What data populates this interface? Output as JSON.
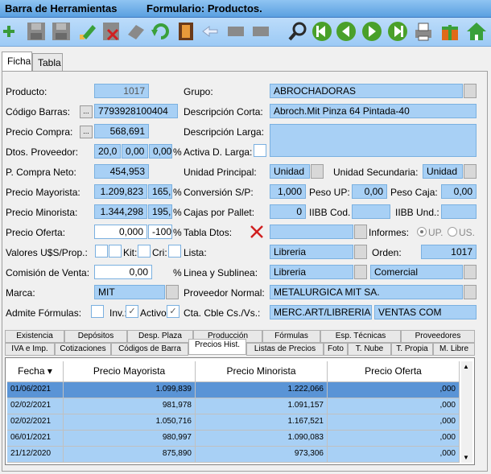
{
  "title": {
    "toolbar_label": "Barra de Herramientas",
    "form_label": "Formulario: Productos."
  },
  "toolbar": [
    "add-icon",
    "save-icon",
    "save-all-icon",
    "edit-icon",
    "delete-icon",
    "eraser-icon",
    "refresh-icon",
    "film-icon",
    "back-icon",
    "blank-icon",
    "blank2-icon",
    "search-icon",
    "first-icon",
    "prev-icon",
    "next-icon",
    "last-icon",
    "printer-icon",
    "gift-icon",
    "home-icon"
  ],
  "tabs": {
    "ficha": "Ficha",
    "tabla": "Tabla"
  },
  "form": {
    "producto_lbl": "Producto:",
    "producto": "1017",
    "codigo_lbl": "Código Barras:",
    "codigo": "7793928100404",
    "precio_compra_lbl": "Precio Compra:",
    "precio_compra": "568,691",
    "dtos_lbl": "Dtos. Proveedor:",
    "dto1": "20,0",
    "dto2": "0,00",
    "dto3": "0,00",
    "pct": "%",
    "compra_neto_lbl": "P. Compra Neto:",
    "compra_neto": "454,953",
    "mayorista_lbl": "Precio Mayorista:",
    "mayorista": "1.209,823",
    "mayorista_pct": "165,",
    "minorista_lbl": "Precio Minorista:",
    "minorista": "1.344,298",
    "minorista_pct": "195,",
    "oferta_lbl": "Precio Oferta:",
    "oferta": "0,000",
    "oferta_pct": "-100",
    "valores_lbl": "Valores U$S/Prop.:",
    "kit_lbl": "Kit:",
    "cri_lbl": "Cri:",
    "comision_lbl": "Comisión de Venta:",
    "comision": "0,00",
    "marca_lbl": "Marca:",
    "marca": "MIT",
    "formulas_lbl": "Admite Fórmulas:",
    "inv_lbl": "Inv.:",
    "activo_lbl": "Activo",
    "grupo_lbl": "Grupo:",
    "grupo": "ABROCHADORAS",
    "desc_corta_lbl": "Descripción Corta:",
    "desc_corta": "Abroch.Mit Pinza 64 Pintada-40",
    "desc_larga_lbl": "Descripción Larga:",
    "activa_dlarga_lbl": "Activa D. Larga:",
    "unidad_principal_lbl": "Unidad Principal:",
    "unidad_principal": "Unidad",
    "unidad_secundaria_lbl": "Unidad Secundaria:",
    "unidad_secundaria": "Unidad",
    "conversion_lbl": "Conversión S/P:",
    "conversion": "1,000",
    "peso_up_lbl": "Peso UP:",
    "peso_up": "0,00",
    "peso_caja_lbl": "Peso Caja:",
    "peso_caja": "0,00",
    "cajas_lbl": "Cajas por Pallet:",
    "cajas": "0",
    "iibb_cod_lbl": "IIBB Cod.",
    "iibb_und_lbl": "IIBB Und.:",
    "tabla_dtos_lbl": "Tabla Dtos:",
    "informes_lbl": "Informes:",
    "up_lbl": "UP.",
    "us_lbl": "US.",
    "lista_lbl": "Lista:",
    "lista": "Libreria",
    "orden_lbl": "Orden:",
    "orden": "1017",
    "linea_lbl": "Linea y Sublinea:",
    "linea": "Libreria",
    "sublinea": "Comercial",
    "proveedor_lbl": "Proveedor Normal:",
    "proveedor": "METALURGICA MIT SA.",
    "cta_lbl": "Cta. Cble Cs./Vs.:",
    "cta1": "MERC.ART/LIBRERIA",
    "cta2": "VENTAS COM"
  },
  "subtabs_row1": [
    "Existencia",
    "Depósitos",
    "Desp. Plaza",
    "Producción",
    "Fórmulas",
    "Esp. Técnicas",
    "Proveedores"
  ],
  "subtabs_row2": [
    "IVA e Imp.",
    "Cotizaciones",
    "Códigos de Barra",
    "Precios Hist.",
    "Listas de Precios",
    "Foto",
    "T. Nube",
    "T. Propia",
    "M. Libre"
  ],
  "grid": {
    "headers": [
      "Fecha",
      "Precio Mayorista",
      "Precio Minorista",
      "Precio Oferta"
    ],
    "rows": [
      [
        "01/06/2021",
        "1.099,839",
        "1.222,066",
        ",000"
      ],
      [
        "02/02/2021",
        "981,978",
        "1.091,157",
        ",000"
      ],
      [
        "02/02/2021",
        "1.050,716",
        "1.167,521",
        ",000"
      ],
      [
        "06/01/2021",
        "980,997",
        "1.090,083",
        ",000"
      ],
      [
        "21/12/2020",
        "875,890",
        "973,306",
        ",000"
      ]
    ]
  }
}
